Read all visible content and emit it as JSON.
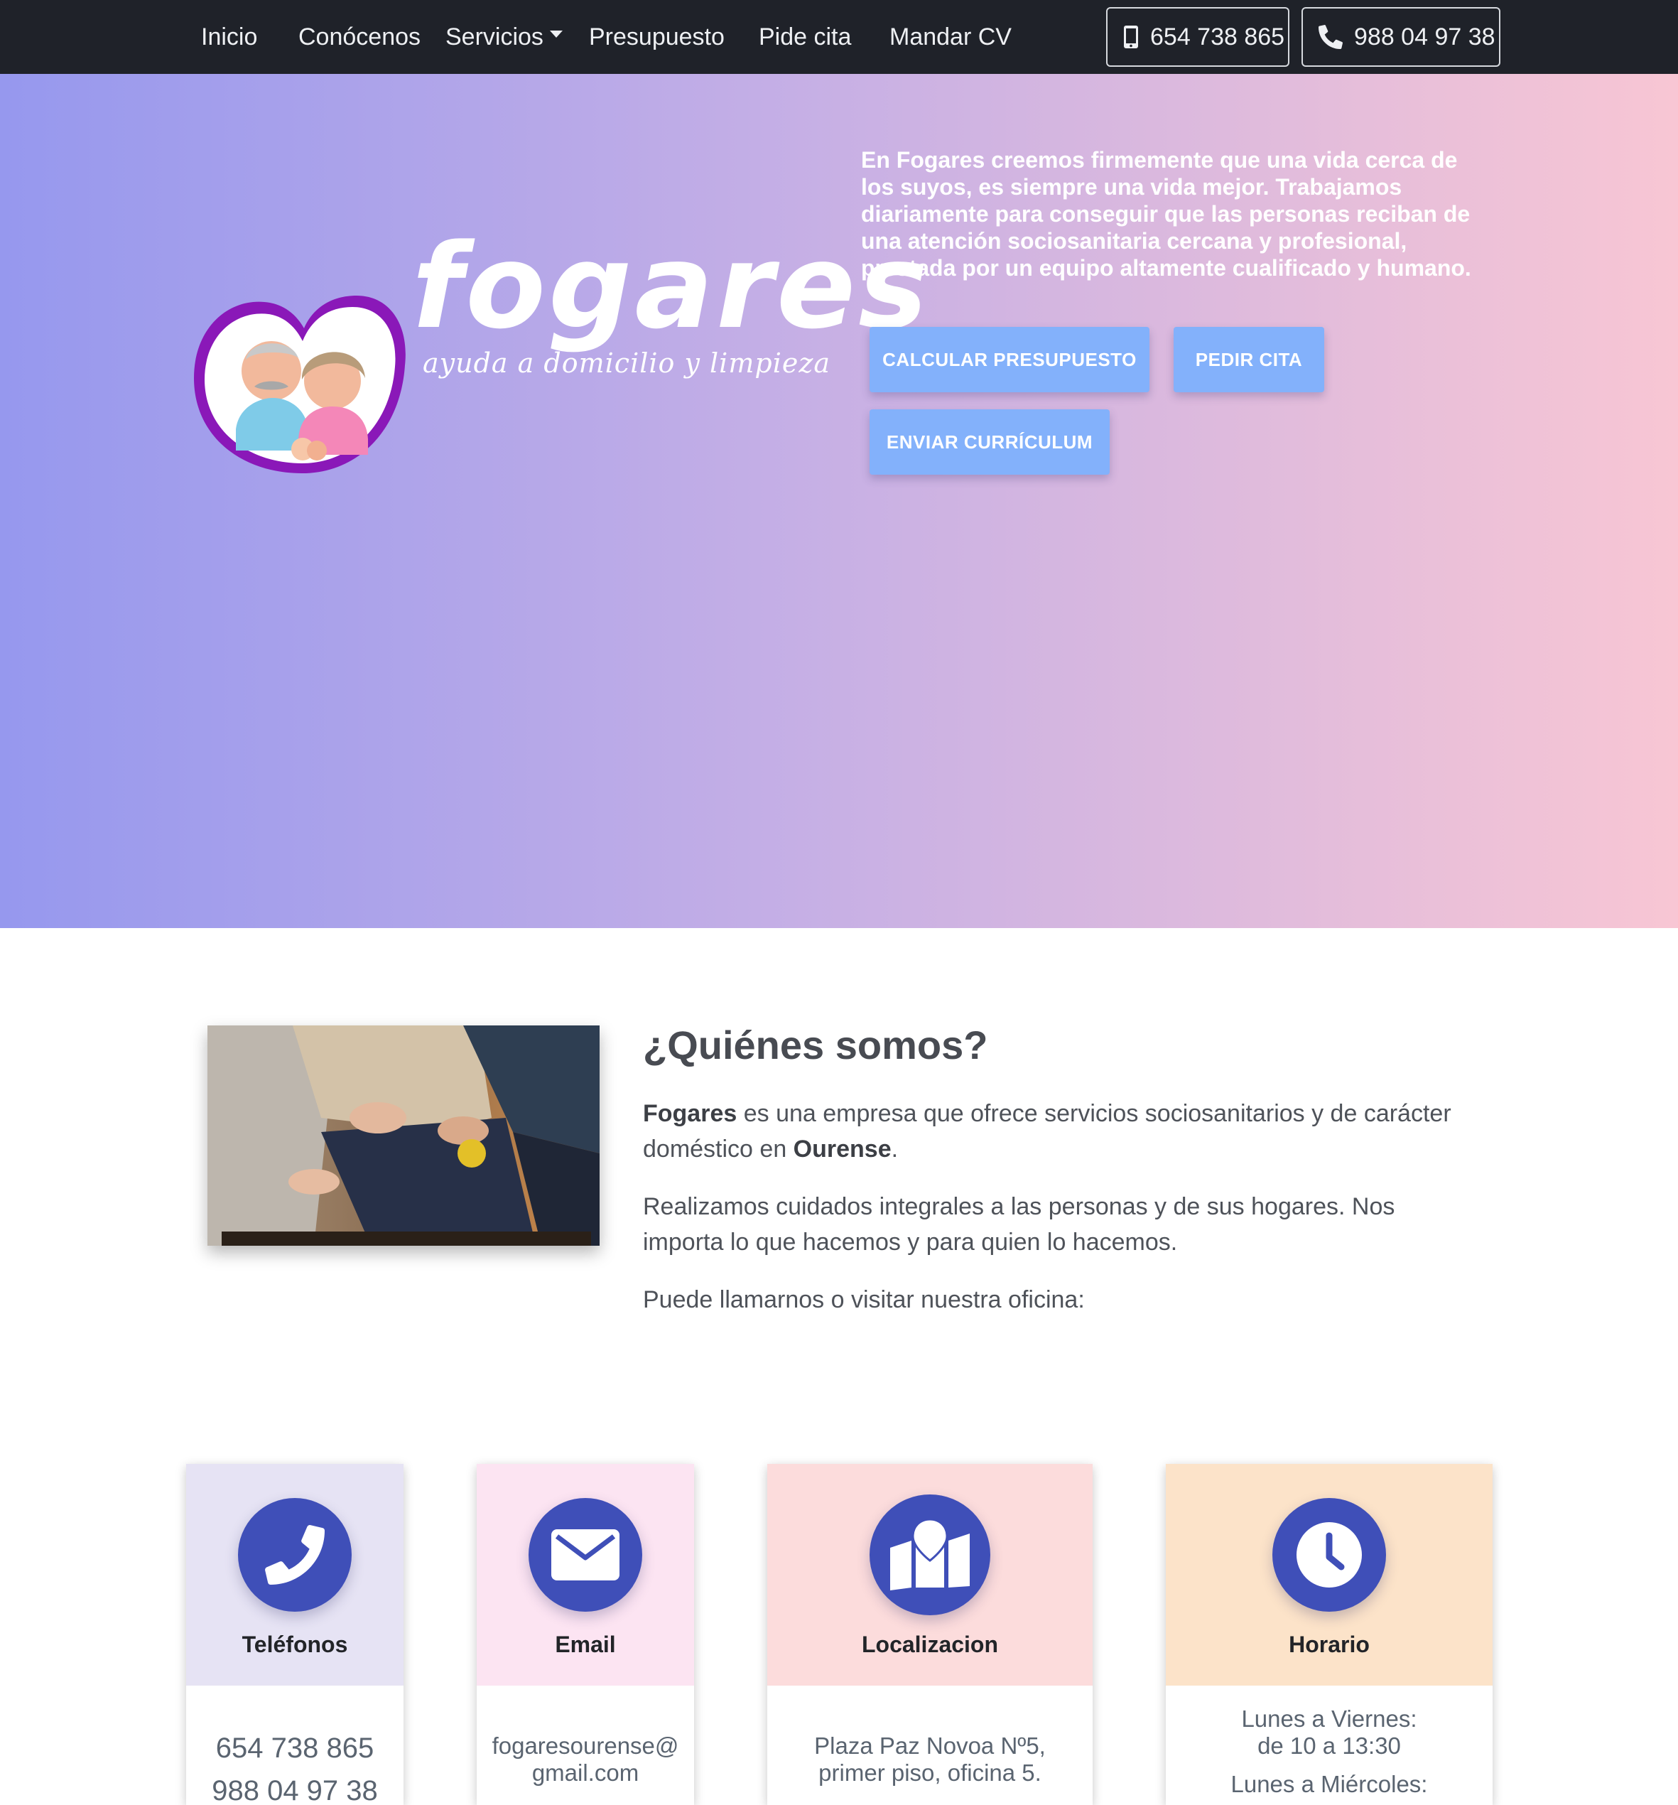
{
  "nav": {
    "items": [
      "Inicio",
      "Conócenos",
      "Servicios",
      "Presupuesto",
      "Pide cita",
      "Mandar CV"
    ],
    "mobile_phone": "654 738 865",
    "landline_phone": "988 04 97 38"
  },
  "hero": {
    "logo_word": "fogares",
    "logo_tagline": "ayuda a domicilio y limpieza",
    "text": "En Fogares creemos firmemente que una vida cerca de los suyos, es siempre una vida mejor. Trabajamos diariamente para conseguir que las personas reciban de una atención sociosanitaria cercana y profesional, prestada por un equipo altamente cualificado y humano.",
    "btn_budget": "CALCULAR PRESUPUESTO",
    "btn_appointment": "PEDIR CITA",
    "btn_cv": "ENVIAR CURRÍCULUM"
  },
  "about": {
    "title": "¿Quiénes somos?",
    "p1_company": "Fogares",
    "p1_text": " es una empresa que ofrece servicios sociosanitarios y de carácter doméstico en ",
    "p1_city": "Ourense",
    "p1_end": ".",
    "p2": "Realizamos cuidados integrales a las personas y de sus hogares. Nos importa lo que hacemos y para quien lo hacemos.",
    "p3": "Puede llamarnos o visitar nuestra oficina:"
  },
  "cards": {
    "phones": {
      "title": "Teléfonos",
      "line1": "654 738 865",
      "line2": "988 04 97 38",
      "bg": "#e6e3f4"
    },
    "email": {
      "title": "Email",
      "line1": "fogaresourense@",
      "line2": "gmail.com",
      "bg": "#fce4f2"
    },
    "location": {
      "title": "Localizacion",
      "line1": "Plaza Paz Novoa Nº5,",
      "line2": "primer piso, oficina 5.",
      "bg": "#fcdcdc"
    },
    "hours": {
      "title": "Horario",
      "line1": "Lunes a Viernes:",
      "line2": "de 10 a 13:30",
      "line3": "Lunes a Miércoles:",
      "bg": "#fce3c9"
    }
  },
  "colors": {
    "navbar": "#1f2229",
    "button": "#83b1fb",
    "icon_circle": "#3f4fb8",
    "logo_heart": "#8a18b8"
  }
}
